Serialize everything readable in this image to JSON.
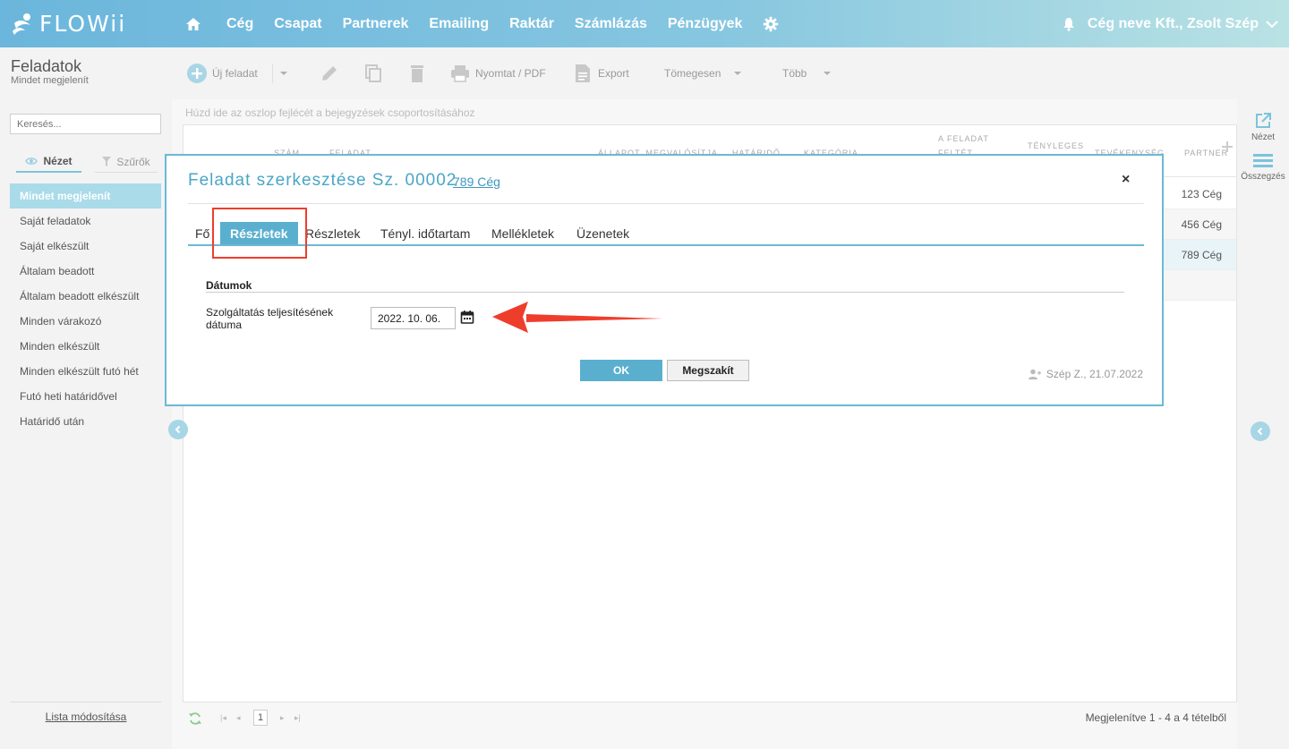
{
  "app": {
    "logo_text": "FLOWii"
  },
  "nav": {
    "items": [
      "Cég",
      "Csapat",
      "Partnerek",
      "Emailing",
      "Raktár",
      "Számlázás",
      "Pénzügyek"
    ],
    "user": "Cég neve Kft., Zsolt Szép"
  },
  "sidebar": {
    "title": "Feladatok",
    "subtitle": "Mindet megjelenít",
    "search_placeholder": "Keresés...",
    "tab_view": "Nézet",
    "tab_filters": "Szűrők",
    "items": [
      "Mindet megjelenít",
      "Saját feladatok",
      "Saját elkészült",
      "Általam beadott",
      "Általam beadott elkészült",
      "Minden várakozó",
      "Minden elkészült",
      "Minden elkészült futó hét",
      "Futó heti határidővel",
      "Határidő után"
    ],
    "footer": "Lista módosítása"
  },
  "toolbar": {
    "new_task": "Új feladat",
    "print": "Nyomtat / PDF",
    "export": "Export",
    "bulk": "Tömegesen",
    "more": "Több"
  },
  "grid": {
    "group_hint": "Húzd ide az oszlop fejlécét a bejegyzések csoportosításához",
    "headers": {
      "szam": "SZÁM",
      "feladat": "FELADAT",
      "allapot": "ÁLLAPOT, MEGVALÓSÍTJA",
      "hatarido": "HATÁRIDŐ",
      "kategoria": "KATEGÓRIA",
      "feltet1": "A FELADAT",
      "feltet2": "FELTÉT",
      "tenyleges": "TÉNYLEGES",
      "tevekenyseg": "TEVÉKENYSÉG",
      "partner": "PARTNER"
    },
    "rows": [
      {
        "partner": "123 Cég"
      },
      {
        "partner": "456 Cég"
      },
      {
        "partner": "789 Cég"
      }
    ],
    "page": "1",
    "info": "Megjelenítve 1 - 4 a 4 tételből"
  },
  "rightrail": {
    "view": "Nézet",
    "summary": "Összegzés"
  },
  "modal": {
    "title": "Feladat szerkesztése Sz. 00002",
    "company_link": "789 Cég",
    "close": "×",
    "tabs": [
      "Fő",
      "Részletek",
      "Részletek",
      "Tényl. időtartam",
      "Mellékletek",
      "Üzenetek"
    ],
    "section_title": "Dátumok",
    "field_label": "Szolgáltatás teljesítésének dátuma",
    "date_value": "2022. 10. 06.",
    "ok": "OK",
    "cancel": "Megszakít",
    "meta": "Szép Z., 21.07.2022"
  },
  "colors": {
    "accent": "#5aafcf",
    "annotation": "#ef3d2c"
  }
}
